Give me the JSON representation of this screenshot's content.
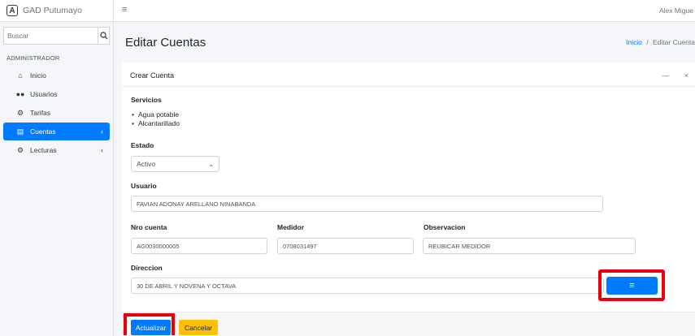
{
  "brand": {
    "logo_letter": "A",
    "name": "GAD Putumayo"
  },
  "sidebar": {
    "search_placeholder": "Buscar",
    "section_header": "ADMINISTRADOR",
    "items": [
      {
        "label": "Inicio",
        "icon": "home-icon"
      },
      {
        "label": "Usuarios",
        "icon": "users-icon"
      },
      {
        "label": "Tarifas",
        "icon": "tarifas-icon"
      },
      {
        "label": "Cuentas",
        "icon": "accounts-icon",
        "active": true
      },
      {
        "label": "Lecturas",
        "icon": "readings-icon"
      }
    ]
  },
  "topbar": {
    "user_name": "Alex Migue"
  },
  "header": {
    "title": "Editar Cuentas",
    "breadcrumb_home": "Inicio",
    "breadcrumb_sep": "/",
    "breadcrumb_current": "Editar Cuenta"
  },
  "card": {
    "title": "Crear Cuenta",
    "tools": "— ×"
  },
  "form": {
    "servicios_label": "Servicios",
    "servicios": [
      "Agua potable",
      "Alcantarillado"
    ],
    "estado_label": "Estado",
    "estado_value": "Activo",
    "usuario_label": "Usuario",
    "usuario_value": "FAVIAN ADONAY ARELLANO NINABANDA",
    "nro_cuenta_label": "Nro cuenta",
    "nro_cuenta_value": "AG0030000005",
    "medidor_label": "Medidor",
    "medidor_value": "0708031497",
    "observacion_label": "Observacion",
    "observacion_value": "REUBICAR MEDIDOR",
    "direccion_label": "Direccion",
    "direccion_value": "30 DE ABRIL Y NOVENA Y OCTAVA"
  },
  "buttons": {
    "update": "Actualizar",
    "cancel": "Cancelar"
  },
  "colors": {
    "primary": "#007bff",
    "warning": "#ffc107",
    "highlight": "#e8000c"
  }
}
